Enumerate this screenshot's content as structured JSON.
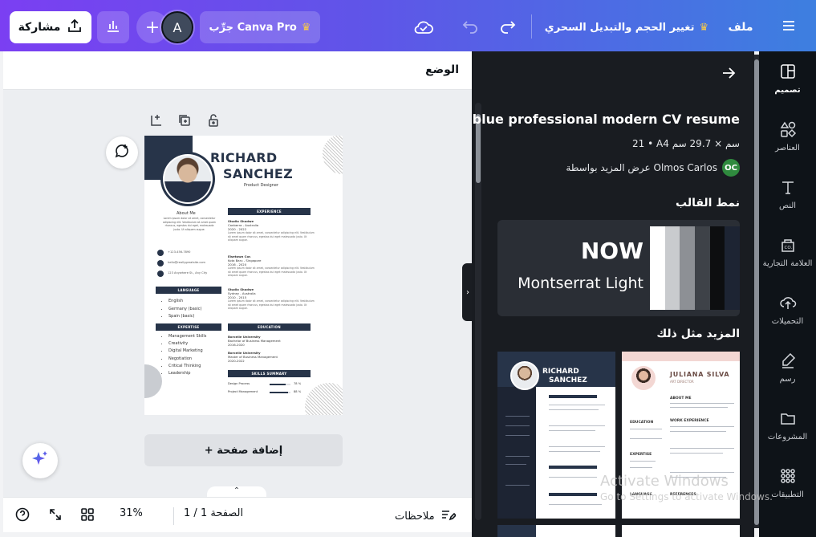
{
  "topbar": {
    "share_label": "مشاركة",
    "try_pro_label": "جرِّب Canva Pro",
    "avatar_initial": "A",
    "resize_label": "تغيير الحجم والتبديل السحري",
    "file_label": "ملف",
    "invite_symbol": "+"
  },
  "canvas": {
    "position_label": "الوضع",
    "add_page_label": "+ إضافة صفحة"
  },
  "resume": {
    "first_name": "RICHARD",
    "last_name": "SANCHEZ",
    "role": "Product Designer",
    "about_title": "About Me",
    "about_text": "Lorem ipsum dolor sit amet, consectetur adipiscing elit. Vestibulum sit amet quam rhoncus, egestas dui eget, malesuada justo. Ut aliquam augue.",
    "phone": "+123-456-7890",
    "email": "hello@reallygreatsite.com",
    "address": "123 Anywhere St., Any City",
    "language_title": "LANGUAGE",
    "languages": [
      "English",
      "Germany (basic)",
      "Spain (basic)"
    ],
    "expertise_title": "EXPERTISE",
    "expertise": [
      "Management Skills",
      "Creativity",
      "Digital Marketing",
      "Negotiation",
      "Critical Thinking",
      "Leadership"
    ],
    "experience_title": "EXPERIENCE",
    "jobs": [
      {
        "company": "Studio Shodwe",
        "place": "Canberra - Australia",
        "years": "2020 - 2022"
      },
      {
        "company": "Elsetown Cor.",
        "place": "Kota Baru - Singapore",
        "years": "2016 - 2020"
      },
      {
        "company": "Studio Shodwe",
        "place": "Sydney - Australia",
        "years": "2010 - 2015"
      }
    ],
    "job_text": "Lorem ipsum dolor sit amet, consectetur adipiscing elit. Vestibulum sit amet quam rhoncus, egestas dui eget malesuada justo. Ut aliquam augue.",
    "education_title": "EDUCATION",
    "education": [
      {
        "school": "Borcelle University",
        "degree": "Bachelor of Business Management",
        "years": "2016-2020"
      },
      {
        "school": "Borcelle University",
        "degree": "Master of Business Management",
        "years": "2020-2022"
      }
    ],
    "skills_title": "SKILLS SUMMARY",
    "skills": [
      {
        "name": "Design Process",
        "value": "78 %",
        "fraction": 0.78
      },
      {
        "name": "Project Management",
        "value": "88 %",
        "fraction": 0.88
      }
    ]
  },
  "statusbar": {
    "notes_label": "ملاحظات",
    "page_label": "الصفحة 1 / 1",
    "zoom": "31%"
  },
  "panel": {
    "title": "blue professional modern CV resume",
    "size": "21 • A4 سم × 29.7 سم",
    "author_badge": "OC",
    "author_text": "عرض المزيد بواسطة Olmos Carlos",
    "style_heading": "نمط القالب",
    "style_headline": "NOW",
    "style_font": "Montserrat Light",
    "swatches": [
      "#ffffff",
      "#c9cbce",
      "#8d9095",
      "#3e4248",
      "#0d0e10",
      "#1d2433"
    ],
    "more_heading": "المزيد مثل ذلك",
    "thumb1": {
      "first": "RICHARD",
      "last": "SANCHEZ"
    },
    "thumb2": {
      "name": "JULIANA SILVA",
      "role": "ART DIRECTOR",
      "about": "ABOUT ME",
      "education": "EDUCATION",
      "work": "WORK EXPERIENCE",
      "expertise": "EXPERTISE",
      "language": "LANGUAGE",
      "references": "REFERENCES"
    }
  },
  "rail": [
    {
      "label": "تصميم",
      "icon": "design-icon"
    },
    {
      "label": "العناصر",
      "icon": "elements-icon"
    },
    {
      "label": "النص",
      "icon": "text-icon"
    },
    {
      "label": "العلامة التجارية",
      "icon": "brand-icon"
    },
    {
      "label": "التحميلات",
      "icon": "uploads-icon"
    },
    {
      "label": "رسم",
      "icon": "draw-icon"
    },
    {
      "label": "المشروعات",
      "icon": "projects-icon"
    },
    {
      "label": "التطبيقات",
      "icon": "apps-icon"
    }
  ],
  "watermark": {
    "line1": "Activate Windows",
    "line2": "Go to Settings to activate Windows."
  }
}
